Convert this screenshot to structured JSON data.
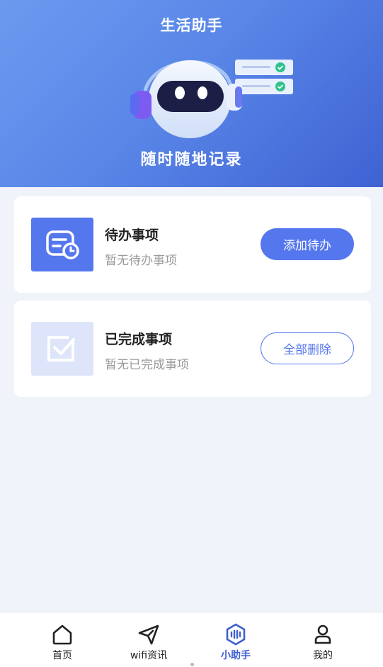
{
  "header": {
    "title": "生活助手",
    "slogan": "随时随地记录"
  },
  "todo_card": {
    "title": "待办事项",
    "subtitle": "暂无待办事项",
    "button_label": "添加待办",
    "icon": "todo-clock-icon"
  },
  "done_card": {
    "title": "已完成事项",
    "subtitle": "暂无已完成事项",
    "button_label": "全部删除",
    "icon": "checkbox-icon"
  },
  "tabbar": {
    "items": [
      {
        "label": "首页",
        "icon": "home-icon",
        "active": false
      },
      {
        "label": "wifi资讯",
        "icon": "send-icon",
        "active": false
      },
      {
        "label": "小助手",
        "icon": "assistant-icon",
        "active": true
      },
      {
        "label": "我的",
        "icon": "user-icon",
        "active": false
      }
    ]
  },
  "colors": {
    "accent": "#5577EE",
    "active_tab": "#3F5FD0",
    "header_gradient_start": "#6C9AEF",
    "header_gradient_end": "#3F62D3"
  }
}
